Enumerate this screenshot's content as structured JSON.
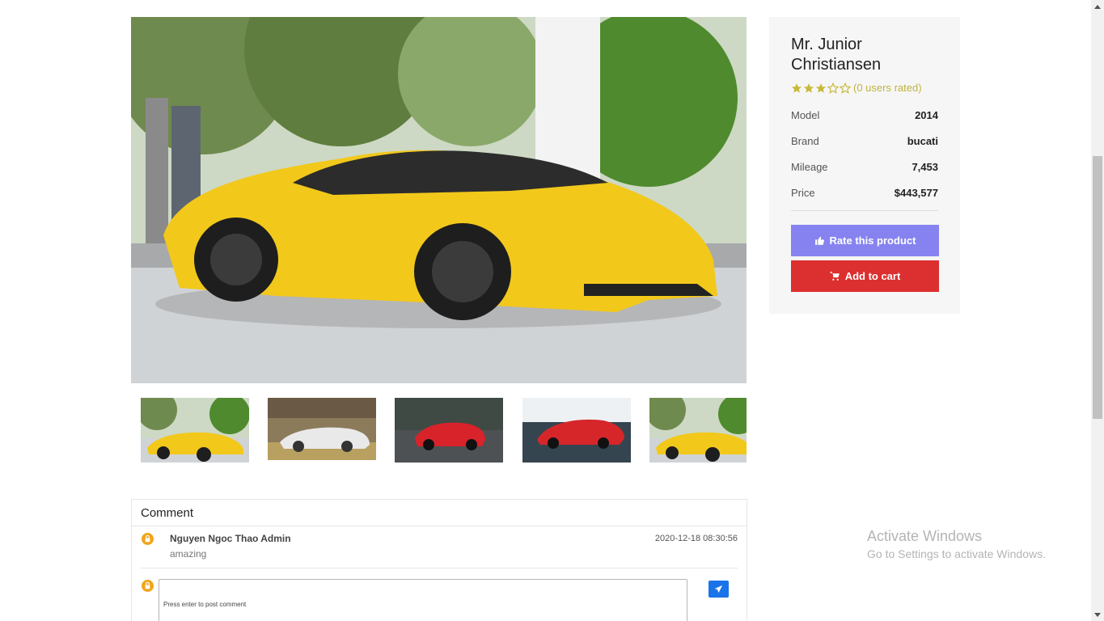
{
  "product": {
    "title": "Mr. Junior Christiansen",
    "rating": {
      "stars": 3,
      "max": 5,
      "text": "(0 users rated)"
    },
    "specs": [
      {
        "label": "Model",
        "value": "2014"
      },
      {
        "label": "Brand",
        "value": "bucati"
      },
      {
        "label": "Mileage",
        "value": "7,453"
      },
      {
        "label": "Price",
        "value": "$443,577"
      }
    ],
    "rate_button": "Rate this product",
    "cart_button": "Add to cart"
  },
  "gallery": {
    "main_image": "yellow-sports-car-photo",
    "thumbnails": [
      {
        "name": "yellow-sports-car-photo"
      },
      {
        "name": "white-supercar-photo"
      },
      {
        "name": "red-coupe-photo"
      },
      {
        "name": "red-supercar-photo"
      },
      {
        "name": "yellow-sports-car-photo"
      }
    ]
  },
  "comments": {
    "heading": "Comment",
    "items": [
      {
        "author": "Nguyen Ngoc Thao Admin",
        "text": "amazing",
        "time": "2020-12-18 08:30:56"
      }
    ],
    "input_placeholder": "Press enter to post comment"
  },
  "watermark": {
    "title": "Activate Windows",
    "subtitle": "Go to Settings to activate Windows."
  },
  "colors": {
    "rate_button": "#8683f0",
    "cart_button": "#dc2f30",
    "star": "#c7b93a",
    "send_button": "#1a73e8",
    "avatar": "#f0a51b"
  }
}
